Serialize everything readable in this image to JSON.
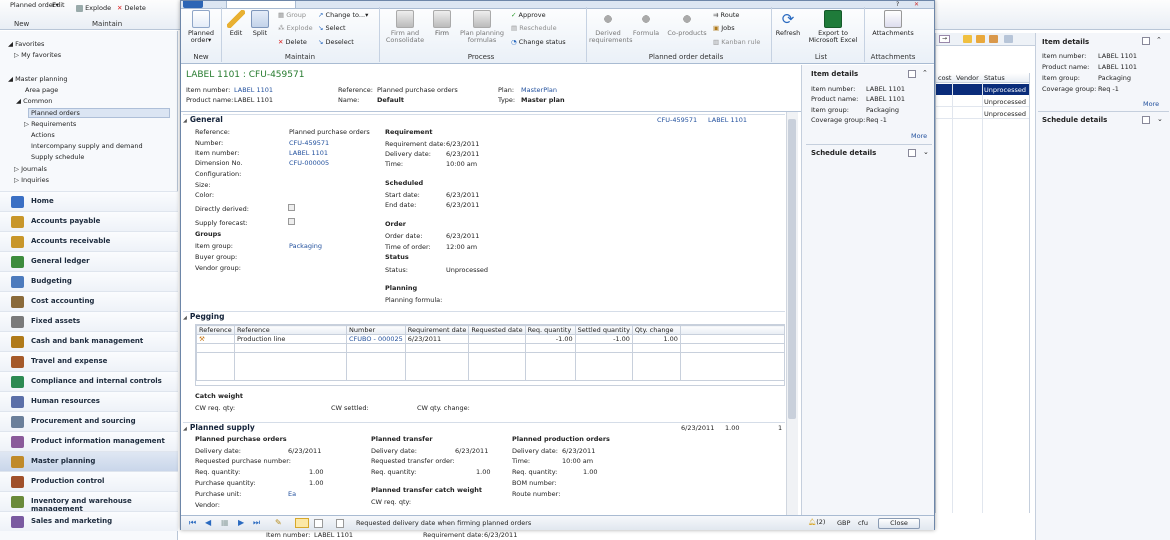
{
  "bg_ribbon": {
    "planned_order_label": "Planned order▾",
    "new_group": "New",
    "edit": "Edit",
    "explode": "Explode",
    "delete": "Delete",
    "maintain_group": "Maintain"
  },
  "navigation": {
    "favorites": "Favorites",
    "my_favorites": "My favorites",
    "master_planning": "Master planning",
    "area_page": "Area page",
    "common": "Common",
    "common_items": [
      "Planned orders",
      "Requirements",
      "Actions",
      "Intercompany supply and demand",
      "Supply schedule"
    ],
    "journals": "Journals",
    "inquiries": "Inquiries",
    "modules": [
      "Home",
      "Accounts payable",
      "Accounts receivable",
      "General ledger",
      "Budgeting",
      "Cost accounting",
      "Fixed assets",
      "Cash and bank management",
      "Travel and expense",
      "Compliance and internal controls",
      "Human resources",
      "Procurement and sourcing",
      "Product information management",
      "Master planning",
      "Production control",
      "Inventory and warehouse management",
      "Sales and marketing"
    ]
  },
  "bg_list": {
    "col_cost": "cost",
    "col_vendor": "Vendor",
    "col_status": "Status",
    "rows": [
      "Unprocessed",
      "Unprocessed",
      "Unprocessed"
    ]
  },
  "bg_factbox": {
    "item_details": "Item details",
    "item_number_lbl": "Item number:",
    "item_number": "LABEL 1101",
    "product_name_lbl": "Product name:",
    "product_name": "LABEL 1101",
    "item_group_lbl": "Item group:",
    "item_group": "Packaging",
    "coverage_lbl": "Coverage group:",
    "coverage": "Req -1",
    "more": "More",
    "schedule_details": "Schedule details"
  },
  "bg_bottom": {
    "item_number_lbl": "Item number:",
    "item_number": "LABEL 1101",
    "req_date_lbl": "Requirement date:",
    "req_date": "6/23/2011"
  },
  "ribbon": {
    "planned_order": "Planned order▾",
    "edit": "Edit",
    "split": "Split",
    "group": "Group",
    "explode": "Explode",
    "delete": "Delete",
    "change_to": "Change to...▾",
    "select": "Select",
    "deselect": "Deselect",
    "firm_consolidate": "Firm and Consolidate",
    "firm": "Firm",
    "plan_formulas": "Plan planning formulas",
    "approve": "Approve",
    "reschedule": "Reschedule",
    "change_status": "Change status",
    "derived_requirements": "Derived requirements",
    "formula": "Formula",
    "co_products": "Co-products",
    "route": "Route",
    "jobs": "Jobs",
    "kanban_rule": "Kanban rule",
    "refresh": "Refresh",
    "export_excel": "Export to Microsoft Excel",
    "attachments": "Attachments",
    "groups": {
      "new": "New",
      "maintain": "Maintain",
      "process": "Process",
      "planned_order_details": "Planned order details",
      "list": "List",
      "attachments": "Attachments"
    }
  },
  "header": {
    "title": "LABEL 1101 : CFU-459571",
    "item_number_lbl": "Item number:",
    "item_number": "LABEL 1101",
    "product_name_lbl": "Product name:",
    "product_name": "LABEL 1101",
    "reference_lbl": "Reference:",
    "reference": "Planned purchase orders",
    "name_lbl": "Name:",
    "name": "Default",
    "plan_lbl": "Plan:",
    "plan": "MasterPlan",
    "type_lbl": "Type:",
    "type": "Master plan"
  },
  "general": {
    "title": "General",
    "summary_id": "CFU-459571",
    "summary_item": "LABEL 1101",
    "reference_lbl": "Reference:",
    "reference": "Planned purchase orders",
    "number_lbl": "Number:",
    "number": "CFU-459571",
    "item_number_lbl": "Item number:",
    "item_number": "LABEL 1101",
    "dimension_lbl": "Dimension No.",
    "dimension": "CFU-000005",
    "configuration_lbl": "Configuration:",
    "size_lbl": "Size:",
    "color_lbl": "Color:",
    "directly_derived_lbl": "Directly derived:",
    "supply_forecast_lbl": "Supply forecast:",
    "groups_title": "Groups",
    "item_group_lbl": "Item group:",
    "item_group": "Packaging",
    "buyer_group_lbl": "Buyer group:",
    "vendor_group_lbl": "Vendor group:",
    "requirement_title": "Requirement",
    "req_date_lbl": "Requirement date:",
    "req_date": "6/23/2011",
    "delivery_date_lbl": "Delivery date:",
    "delivery_date": "6/23/2011",
    "time_lbl": "Time:",
    "time": "10:00 am",
    "scheduled_title": "Scheduled",
    "start_date_lbl": "Start date:",
    "start_date": "6/23/2011",
    "end_date_lbl": "End date:",
    "end_date": "6/23/2011",
    "order_title": "Order",
    "order_date_lbl": "Order date:",
    "order_date": "6/23/2011",
    "time_of_order_lbl": "Time of order:",
    "time_of_order": "12:00 am",
    "status_title": "Status",
    "status_lbl": "Status:",
    "status": "Unprocessed",
    "planning_title": "Planning",
    "planning_formula_lbl": "Planning formula:"
  },
  "pegging": {
    "title": "Pegging",
    "columns": [
      "Reference",
      "Reference",
      "Number",
      "Requirement date",
      "Requested date",
      "Req. quantity",
      "Settled quantity",
      "Qty. change"
    ],
    "row": {
      "reference": "Production line",
      "number": "CFUBO - 000025",
      "req_date": "6/23/2011",
      "req_qty": "-1.00",
      "settled": "-1.00",
      "qty_change": "1.00"
    },
    "catch_weight": "Catch weight",
    "cw_req_qty": "CW req. qty:",
    "cw_settled": "CW settled:",
    "cw_qty_change": "CW qty. change:"
  },
  "planned_supply": {
    "title": "Planned supply",
    "summary_date": "6/23/2011",
    "summary_qty": "1.00",
    "summary_count": "1",
    "ppo_title": "Planned purchase orders",
    "ppo_delivery_lbl": "Delivery date:",
    "ppo_delivery": "6/23/2011",
    "ppo_req_purch_lbl": "Requested purchase number:",
    "ppo_req_qty_lbl": "Req. quantity:",
    "ppo_req_qty": "1.00",
    "ppo_purch_qty_lbl": "Purchase quantity:",
    "ppo_purch_qty": "1.00",
    "ppo_unit_lbl": "Purchase unit:",
    "ppo_unit": "Ea",
    "ppo_vendor_lbl": "Vendor:",
    "pt_title": "Planned transfer",
    "pt_delivery_lbl": "Delivery date:",
    "pt_delivery": "6/23/2011",
    "pt_req_order_lbl": "Requested transfer order:",
    "pt_req_qty_lbl": "Req. quantity:",
    "pt_req_qty": "1.00",
    "ptcw_title": "Planned transfer catch weight",
    "ptcw_cw_req_lbl": "CW req. qty:",
    "ppr_title": "Planned production orders",
    "ppr_delivery_lbl": "Delivery date:",
    "ppr_delivery": "6/23/2011",
    "ppr_time_lbl": "Time:",
    "ppr_time": "10:00 am",
    "ppr_req_qty_lbl": "Req. quantity:",
    "ppr_req_qty": "1.00",
    "ppr_bom_lbl": "BOM number:",
    "ppr_route_lbl": "Route number:"
  },
  "right_pane": {
    "item_details": "Item details",
    "item_number_lbl": "Item number:",
    "item_number": "LABEL 1101",
    "product_name_lbl": "Product name:",
    "product_name": "LABEL 1101",
    "item_group_lbl": "Item group:",
    "item_group": "Packaging",
    "coverage_lbl": "Coverage group:",
    "coverage": "Req -1",
    "more": "More",
    "schedule_details": "Schedule details"
  },
  "statusbar": {
    "message": "Requested delivery date when firming planned orders",
    "alerts": "(2)",
    "currency": "GBP",
    "company": "cfu",
    "close": "Close"
  }
}
